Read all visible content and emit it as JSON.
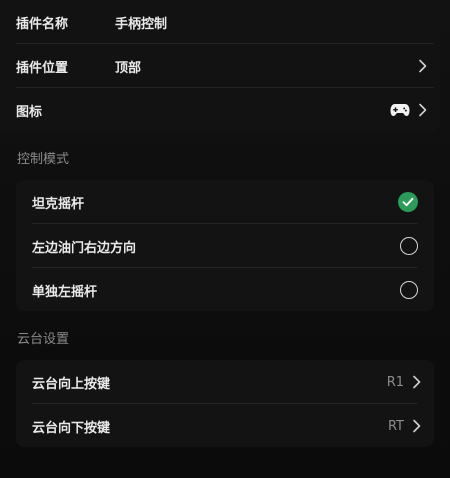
{
  "plugin": {
    "name_label": "插件名称",
    "name_value": "手柄控制",
    "position_label": "插件位置",
    "position_value": "顶部",
    "icon_label": "图标"
  },
  "control_mode": {
    "title": "控制模式",
    "options": [
      {
        "label": "坦克摇杆",
        "selected": true
      },
      {
        "label": "左边油门右边方向",
        "selected": false
      },
      {
        "label": "单独左摇杆",
        "selected": false
      }
    ]
  },
  "gimbal": {
    "title": "云台设置",
    "items": [
      {
        "label": "云台向上按键",
        "value": "R1"
      },
      {
        "label": "云台向下按键",
        "value": "RT"
      }
    ]
  },
  "colors": {
    "background": "#0b0b0b",
    "card": "#131313",
    "accent_check": "#2c9a58",
    "text": "#e9e9e9",
    "muted": "#8a8a8a"
  },
  "icons": {
    "plugin_icon": "gamepad-icon",
    "chevron": "chevron-right-icon",
    "selected": "check-circle-icon",
    "unselected": "radio-empty-icon"
  }
}
